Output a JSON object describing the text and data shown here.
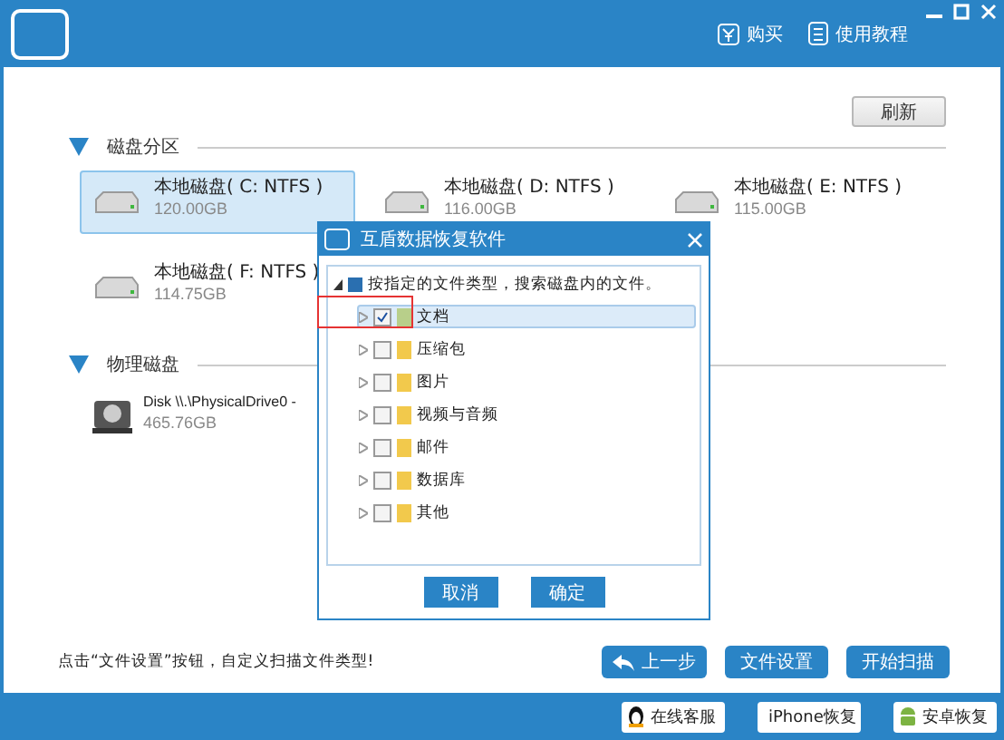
{
  "header": {
    "links": [
      {
        "label": "购买",
        "kind": "buy"
      },
      {
        "label": "使用教程",
        "kind": "guide"
      }
    ]
  },
  "refresh_button": "刷新",
  "partitions_section": {
    "title": "磁盘分区",
    "expanded": true,
    "drives": [
      {
        "name": "本地磁盘( C: NTFS )",
        "size": "120.00GB",
        "selected": true
      },
      {
        "name": "本地磁盘( D: NTFS )",
        "size": "116.00GB",
        "selected": false
      },
      {
        "name": "本地磁盘( E: NTFS )",
        "size": "115.00GB",
        "selected": false
      },
      {
        "name": "本地磁盘( F: NTFS )",
        "size": "114.75GB",
        "selected": false
      }
    ]
  },
  "physical_section": {
    "title": "物理磁盘",
    "expanded": true,
    "disks": [
      {
        "name": "Disk \\\\.\\PhysicalDrive0 -",
        "size": "465.76GB",
        "selected": false
      }
    ]
  },
  "hint": "点击“文件设置”按钮，自定义扫描文件类型!",
  "actions": [
    {
      "label": "上一步",
      "kind": "back"
    },
    {
      "label": "文件设置",
      "kind": "plain"
    },
    {
      "label": "开始扫描",
      "kind": "plain"
    }
  ],
  "footer_buttons": [
    {
      "label": "在线客服",
      "kind": "qq"
    },
    {
      "label": "iPhone恢复",
      "kind": "apple"
    },
    {
      "label": "安卓恢复",
      "kind": "android"
    }
  ],
  "dialog": {
    "title": "互盾数据恢复软件",
    "tree": {
      "label": "按指定的文件类型，搜索磁盘内的文件。",
      "expanded": true,
      "children": [
        {
          "label": "文档",
          "checked": true,
          "selected": true,
          "expanded": false
        },
        {
          "label": "压缩包",
          "checked": false,
          "selected": false,
          "expanded": false
        },
        {
          "label": "图片",
          "checked": false,
          "selected": false,
          "expanded": false
        },
        {
          "label": "视频与音频",
          "checked": false,
          "selected": false,
          "expanded": false
        },
        {
          "label": "邮件",
          "checked": false,
          "selected": false,
          "expanded": false
        },
        {
          "label": "数据库",
          "checked": false,
          "selected": false,
          "expanded": false
        },
        {
          "label": "其他",
          "checked": false,
          "selected": false,
          "expanded": false
        }
      ]
    },
    "buttons": [
      "取消",
      "确定"
    ]
  }
}
